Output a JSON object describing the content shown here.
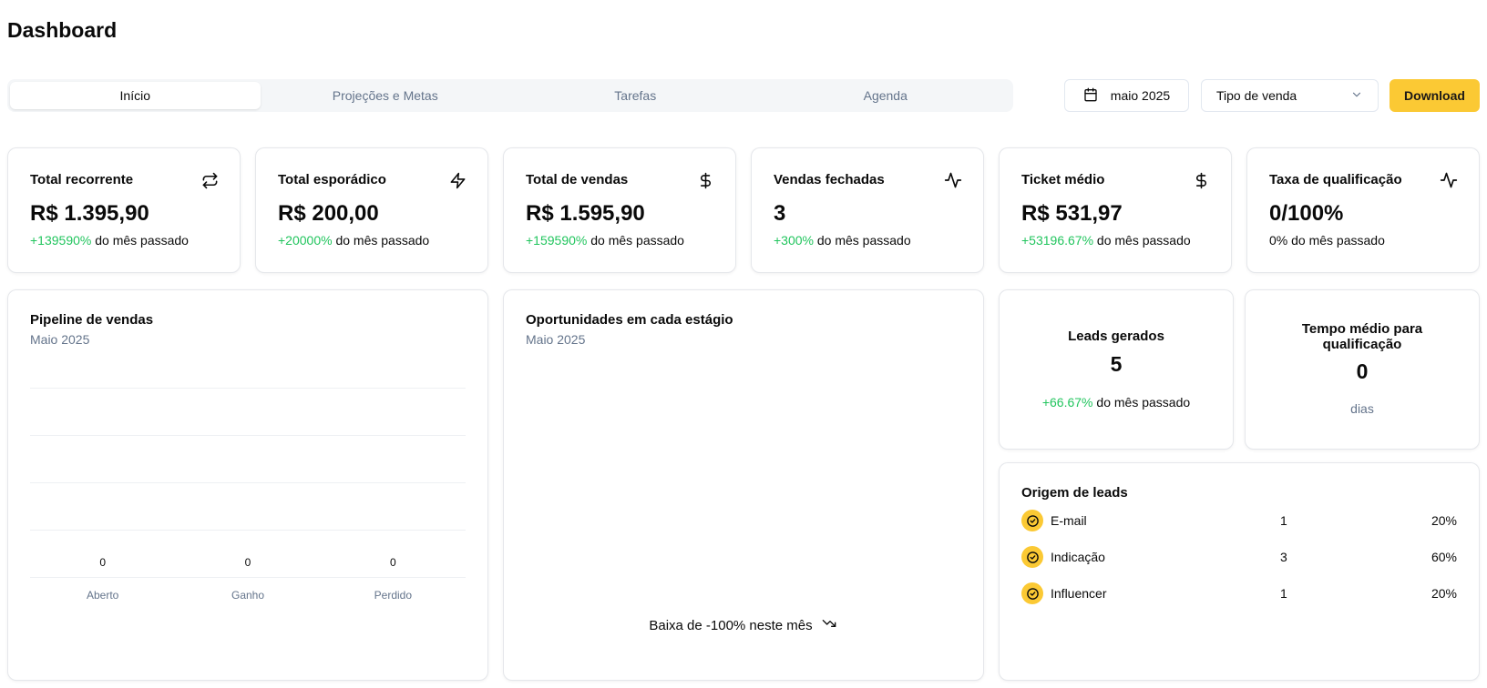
{
  "page": {
    "title": "Dashboard"
  },
  "tabs": [
    {
      "label": "Início",
      "active": true
    },
    {
      "label": "Projeções e Metas",
      "active": false
    },
    {
      "label": "Tarefas",
      "active": false
    },
    {
      "label": "Agenda",
      "active": false
    }
  ],
  "toolbar": {
    "date_label": "maio 2025",
    "date_icon": "calendar-icon",
    "select_value": "Tipo de venda",
    "select_icon": "chevron-down-icon",
    "download_label": "Download"
  },
  "colors": {
    "accent": "#fbc934",
    "positive": "#22c55e",
    "muted": "#64748b"
  },
  "stats": [
    {
      "title": "Total recorrente",
      "icon": "repeat-icon",
      "value": "R$ 1.395,90",
      "value_color": "green",
      "change": "+139590%",
      "change_suffix": " do mês passado"
    },
    {
      "title": "Total esporádico",
      "icon": "zap-icon",
      "value": "R$ 200,00",
      "value_color": "yellow",
      "change": "+20000%",
      "change_suffix": " do mês passado"
    },
    {
      "title": "Total de vendas",
      "icon": "dollar-icon",
      "value": "R$ 1.595,90",
      "value_color": "default",
      "change": "+159590%",
      "change_suffix": " do mês passado"
    },
    {
      "title": "Vendas fechadas",
      "icon": "activity-icon",
      "value": "3",
      "value_color": "default",
      "change": "+300%",
      "change_suffix": " do mês passado"
    },
    {
      "title": "Ticket médio",
      "icon": "dollar-icon",
      "value": "R$ 531,97",
      "value_color": "default",
      "change": "+53196.67%",
      "change_suffix": " do mês passado"
    },
    {
      "title": "Taxa de qualificação",
      "icon": "activity-icon",
      "value": "0/100%",
      "value_color": "default",
      "change": "",
      "change_suffix": "0% do mês passado"
    }
  ],
  "pipeline": {
    "title": "Pipeline de vendas",
    "subtitle": "Maio 2025",
    "chart_data": {
      "type": "bar",
      "categories": [
        "Aberto",
        "Ganho",
        "Perdido"
      ],
      "values": [
        0,
        0,
        0
      ],
      "grid": true
    }
  },
  "opportunities": {
    "title": "Oportunidades em cada estágio",
    "subtitle": "Maio 2025",
    "trend_text": "Baixa de -100% neste mês",
    "trend_icon": "trending-down-icon"
  },
  "leads": {
    "title": "Leads gerados",
    "value": "5",
    "change": "+66.67%",
    "change_suffix": " do mês passado"
  },
  "qualification_time": {
    "title_line1": "Tempo médio para",
    "title_line2": "qualificação",
    "value": "0",
    "unit": "dias"
  },
  "lead_origin": {
    "title": "Origem de leads",
    "rows": [
      {
        "name": "E-mail",
        "count": "1",
        "pct": "20%"
      },
      {
        "name": "Indicação",
        "count": "3",
        "pct": "60%"
      },
      {
        "name": "Influencer",
        "count": "1",
        "pct": "20%"
      }
    ]
  }
}
